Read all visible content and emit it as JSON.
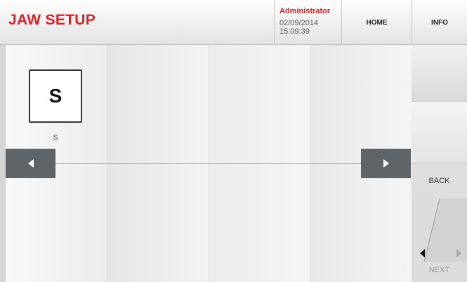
{
  "header": {
    "title": "JAW SETUP",
    "user": "Administrator",
    "date": "02/09/2014",
    "time": "15:09:39",
    "home_label": "HOME",
    "info_label": "INFO"
  },
  "jaw": {
    "symbol": "S",
    "caption": "S"
  },
  "side": {
    "back_label": "BACK",
    "next_label": "NEXT"
  },
  "icons": {
    "scroll_left": "triangle-left-icon",
    "scroll_right": "triangle-right-icon",
    "page_prev": "triangle-left-icon",
    "page_next": "triangle-right-icon"
  },
  "colors": {
    "accent": "#d8232a",
    "arrow_button": "#5f6468",
    "next_disabled": "#9a9a9a"
  }
}
